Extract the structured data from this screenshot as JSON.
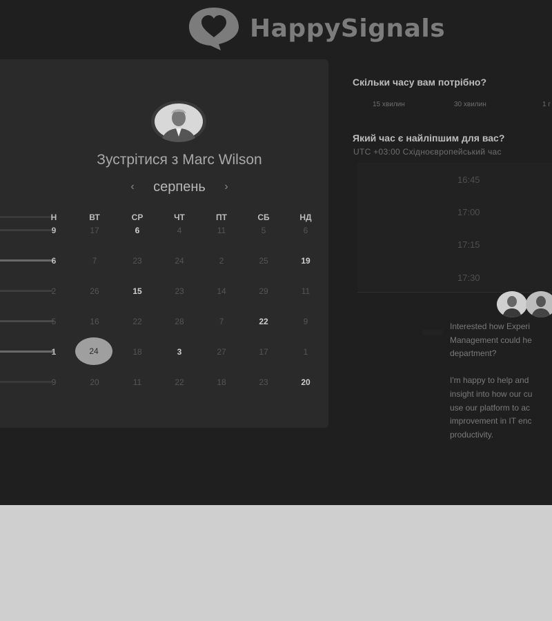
{
  "logo": {
    "brand_text": "HappySignals",
    "icon": "heart-chat-bubble-icon"
  },
  "calendar": {
    "title": "Зустрітися з Marc Wilson",
    "month": "серпень",
    "prev_icon": "chevron-left-icon",
    "next_icon": "chevron-right-icon",
    "weekdays": [
      "Н",
      "ВТ",
      "СР",
      "ЧТ",
      "ПТ",
      "СБ",
      "НД"
    ],
    "rows": [
      [
        "9",
        "17",
        "6",
        "4",
        "11",
        "5",
        "6"
      ],
      [
        "6",
        "7",
        "23",
        "24",
        "2",
        "25",
        "19"
      ],
      [
        "2",
        "26",
        "15",
        "23",
        "14",
        "29",
        "11"
      ],
      [
        "5",
        "16",
        "22",
        "28",
        "7",
        "22",
        "9"
      ],
      [
        "1",
        "24",
        "18",
        "3",
        "27",
        "17",
        "1"
      ],
      [
        "9",
        "20",
        "11",
        "22",
        "18",
        "23",
        "20"
      ]
    ],
    "selected_day": "24"
  },
  "duration": {
    "question": "Скільки часу вам потрібно?",
    "options": [
      "15 хвилин",
      "30 хвилин",
      "1 г"
    ]
  },
  "time": {
    "question": "Який час є найліпшим для вас?",
    "timezone": "UTC +03:00 Східноєвропейський час",
    "slots": [
      "16:45",
      "17:00",
      "17:15",
      "17:30"
    ]
  },
  "message": {
    "lines": [
      "Interested how Experi",
      "Management could he",
      "department?",
      "",
      "I'm happy to help and",
      "insight into how our cu",
      "use our platform to ac",
      "improvement in IT enc",
      "productivity."
    ]
  }
}
